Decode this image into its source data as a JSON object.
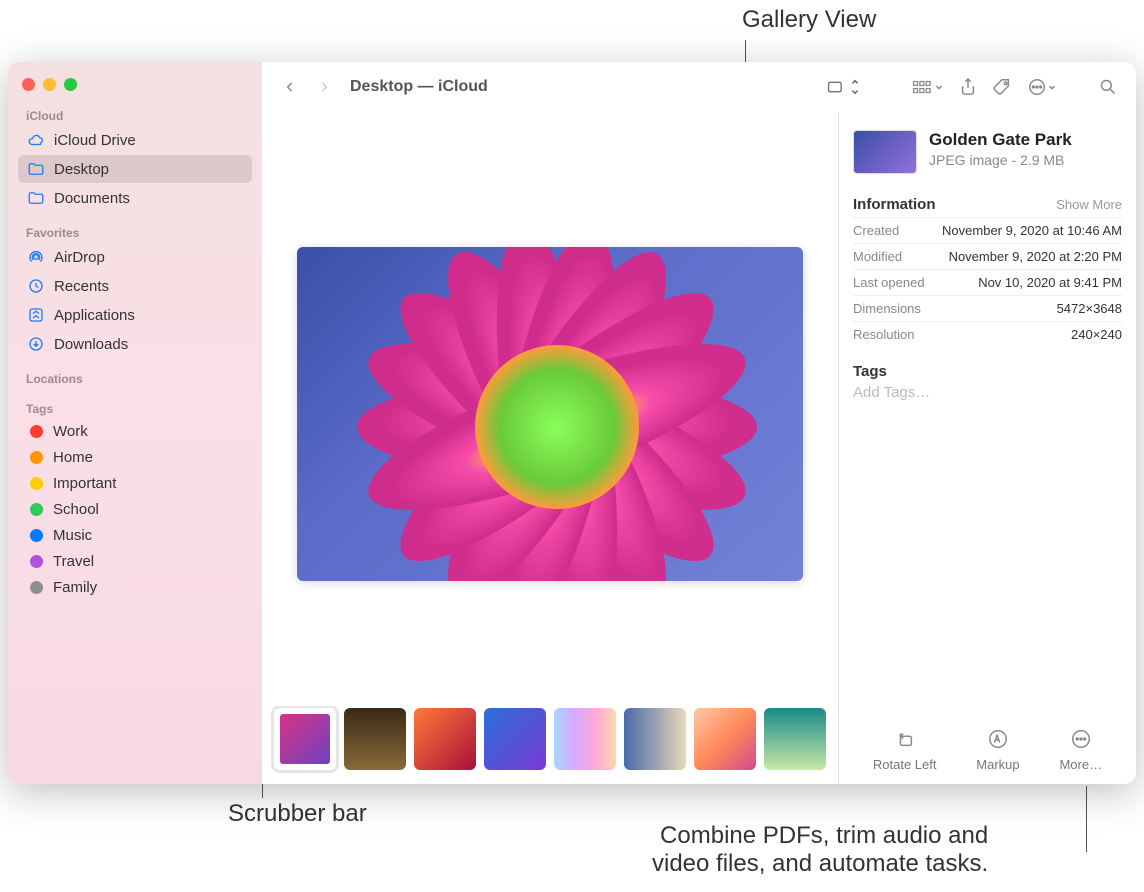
{
  "callouts": {
    "gallery_view": "Gallery View",
    "scrubber_bar": "Scrubber bar",
    "combine": "Combine PDFs, trim audio and\nvideo files, and automate tasks."
  },
  "window": {
    "title": "Desktop — iCloud"
  },
  "sidebar": {
    "sec_icloud": "iCloud",
    "icloud_items": [
      {
        "label": "iCloud Drive",
        "icon": "cloud"
      },
      {
        "label": "Desktop",
        "icon": "folder",
        "selected": true
      },
      {
        "label": "Documents",
        "icon": "folder"
      }
    ],
    "sec_fav": "Favorites",
    "fav_items": [
      {
        "label": "AirDrop",
        "icon": "airdrop"
      },
      {
        "label": "Recents",
        "icon": "clock"
      },
      {
        "label": "Applications",
        "icon": "apps"
      },
      {
        "label": "Downloads",
        "icon": "download"
      }
    ],
    "sec_loc": "Locations",
    "sec_tags": "Tags",
    "tags": [
      {
        "label": "Work",
        "color": "#ff3b30"
      },
      {
        "label": "Home",
        "color": "#ff9500"
      },
      {
        "label": "Important",
        "color": "#ffcc00"
      },
      {
        "label": "School",
        "color": "#34c759"
      },
      {
        "label": "Music",
        "color": "#007aff"
      },
      {
        "label": "Travel",
        "color": "#af52de"
      },
      {
        "label": "Family",
        "color": "#8e8e93"
      }
    ]
  },
  "inspector": {
    "title": "Golden Gate Park",
    "subtitle": "JPEG image - 2.9 MB",
    "info_h": "Information",
    "show_more": "Show More",
    "rows": [
      {
        "k": "Created",
        "v": "November 9, 2020 at 10:46 AM"
      },
      {
        "k": "Modified",
        "v": "November 9, 2020 at 2:20 PM"
      },
      {
        "k": "Last opened",
        "v": "Nov 10, 2020 at 9:41 PM"
      },
      {
        "k": "Dimensions",
        "v": "5472×3648"
      },
      {
        "k": "Resolution",
        "v": "240×240"
      }
    ],
    "tags_h": "Tags",
    "tags_ph": "Add Tags…",
    "actions": {
      "rotate": "Rotate Left",
      "markup": "Markup",
      "more": "More…"
    }
  },
  "thumbs": [
    {
      "g": "linear-gradient(135deg,#d63384,#6f42c1)",
      "sel": true
    },
    {
      "g": "linear-gradient(180deg,#3a2a15,#8a6a3a)"
    },
    {
      "g": "linear-gradient(135deg,#ff7a3a,#a8103a)"
    },
    {
      "g": "linear-gradient(135deg,#2a6fd6,#7a3ad6)"
    },
    {
      "g": "linear-gradient(90deg,#a8d8ff,#d8a8ff,#ffa8d8,#ffd8a8)"
    },
    {
      "g": "linear-gradient(90deg,#4a6aa8,#e8d8b8)"
    },
    {
      "g": "linear-gradient(135deg,#ffc8a8,#ff8a5a,#d04a8a)"
    },
    {
      "g": "linear-gradient(180deg,#1a8a8a,#c8e8a8)"
    }
  ]
}
